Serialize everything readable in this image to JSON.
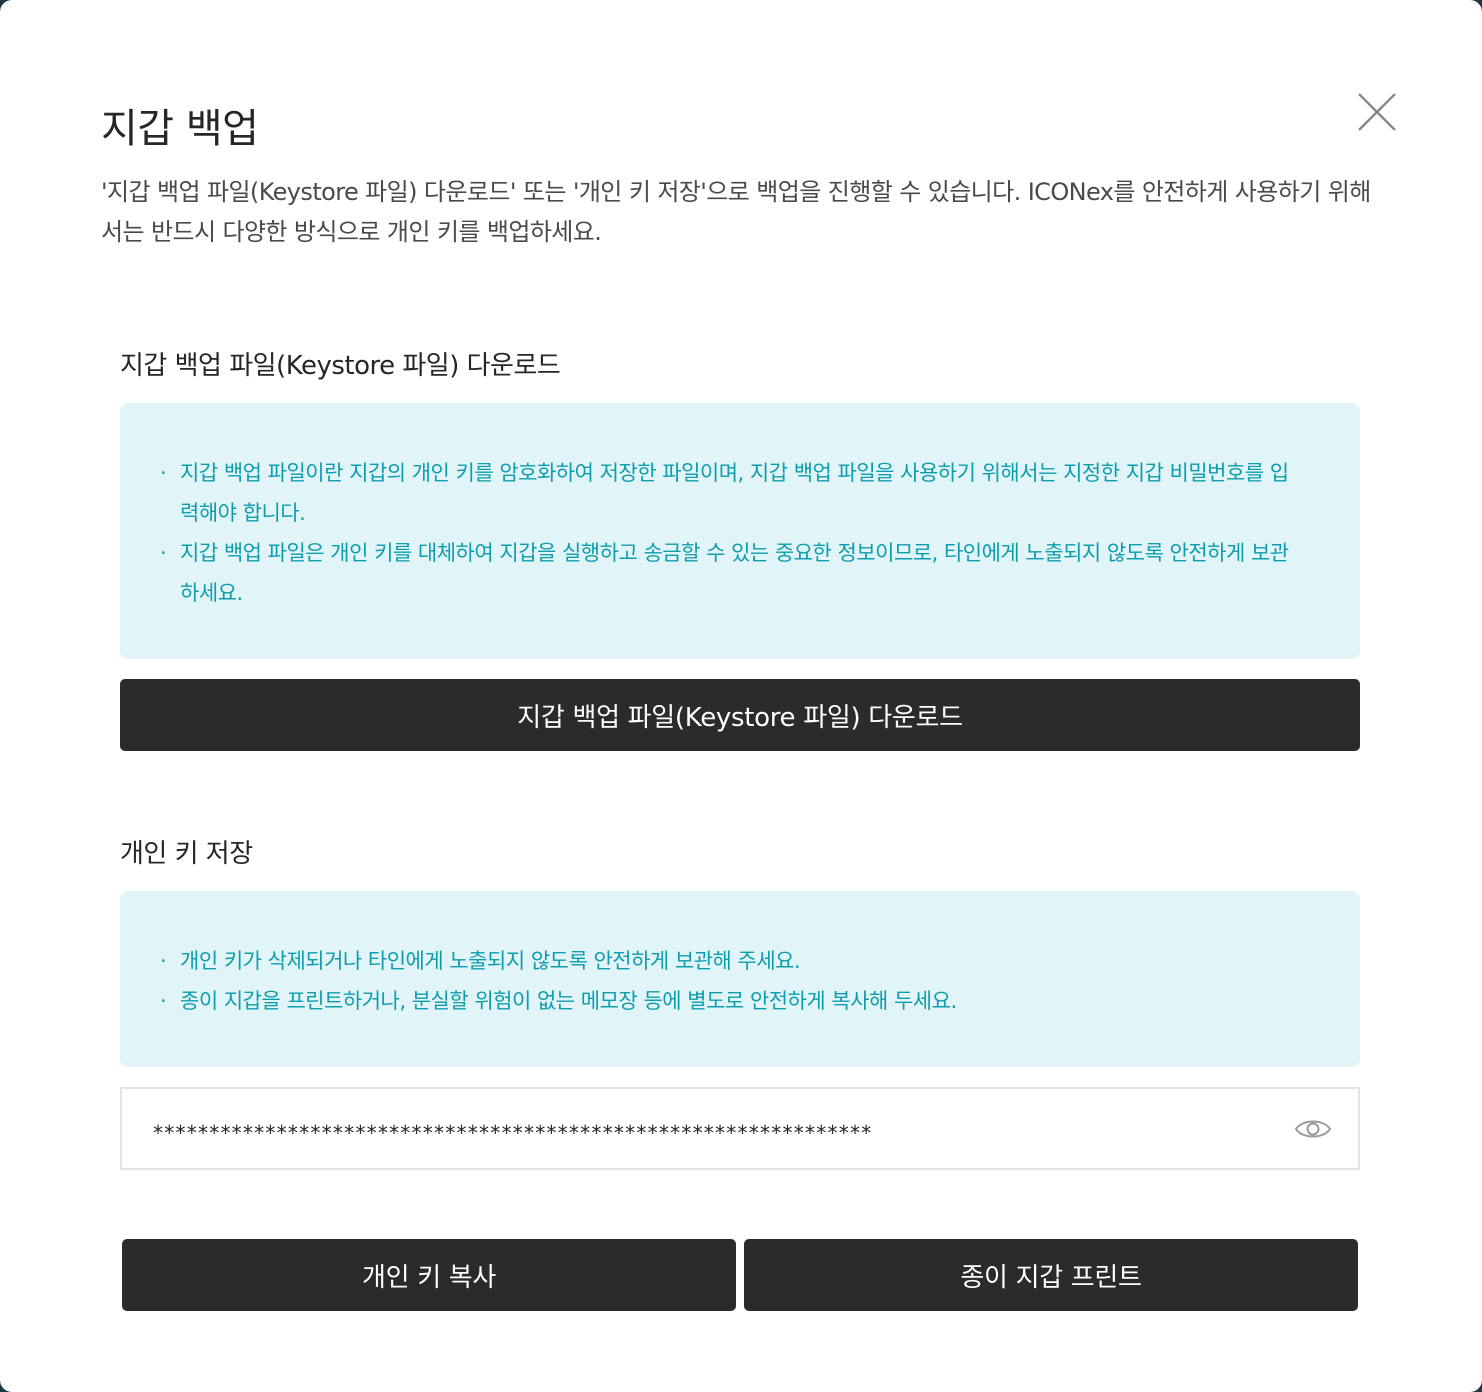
{
  "modal": {
    "title": "지갑 백업",
    "description": "'지갑 백업 파일(Keystore 파일) 다운로드' 또는 '개인 키 저장'으로 백업을 진행할 수 있습니다. ICONex를 안전하게 사용하기 위해서는 반드시 다양한 방식으로 개인 키를 백업하세요.",
    "close_icon": "close-icon"
  },
  "keystore": {
    "heading": "지갑 백업 파일(Keystore 파일) 다운로드",
    "notes": [
      "지갑 백업 파일이란 지갑의 개인 키를 암호화하여 저장한 파일이며, 지갑 백업 파일을 사용하기 위해서는 지정한 지갑 비밀번호를 입력해야 합니다.",
      "지갑 백업 파일은 개인 키를 대체하여 지갑을 실행하고 송금할 수 있는 중요한 정보이므로, 타인에게 노출되지 않도록 안전하게 보관하세요."
    ],
    "download_label": "지갑 백업 파일(Keystore 파일) 다운로드"
  },
  "private_key": {
    "heading": "개인 키 저장",
    "notes": [
      "개인 키가 삭제되거나 타인에게 노출되지 않도록 안전하게 보관해 주세요.",
      "종이 지갑을 프린트하거나, 분실할 위험이 없는 메모장 등에 별도로 안전하게 복사해 두세요."
    ],
    "masked_value": "****************************************************************",
    "eye_icon": "eye-icon",
    "copy_label": "개인 키 복사",
    "print_label": "종이 지갑 프린트"
  },
  "colors": {
    "accent_text": "#0e9dad",
    "info_bg": "#e1f5f8",
    "button_bg": "#2b2b2b"
  }
}
